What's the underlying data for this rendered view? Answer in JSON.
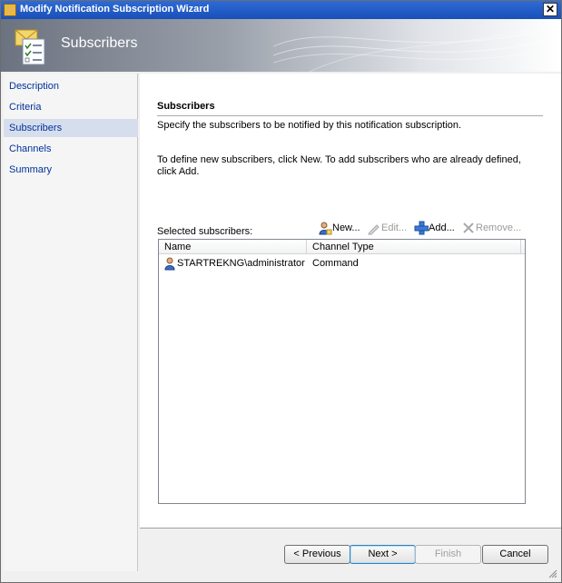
{
  "window": {
    "title": "Modify Notification Subscription Wizard",
    "close_glyph": "✕"
  },
  "banner": {
    "heading": "Subscribers",
    "icon": "envelope-checklist-icon"
  },
  "nav": {
    "items": [
      {
        "label": "Description"
      },
      {
        "label": "Criteria"
      },
      {
        "label": "Subscribers",
        "selected": true
      },
      {
        "label": "Channels"
      },
      {
        "label": "Summary"
      }
    ]
  },
  "page": {
    "title": "Subscribers",
    "description": "Specify the subscribers to be notified by this notification subscription.",
    "instructions": "To define new subscribers, click New.  To add subscribers who are already defined, click Add.",
    "selected_label": "Selected subscribers:"
  },
  "toolbar": {
    "new_label": "New...",
    "edit_label": "Edit...",
    "add_label": "Add...",
    "remove_label": "Remove..."
  },
  "grid": {
    "columns": [
      "Name",
      "Channel Type"
    ],
    "rows": [
      {
        "name": "STARTREKNG\\administrator",
        "channel": "Command"
      }
    ]
  },
  "buttons": {
    "previous": "< Previous",
    "next": "Next >",
    "finish": "Finish",
    "cancel": "Cancel"
  },
  "colors": {
    "accent": "#003399",
    "selected_nav": "#d6deed",
    "titlebar": "#2d6bd6"
  }
}
